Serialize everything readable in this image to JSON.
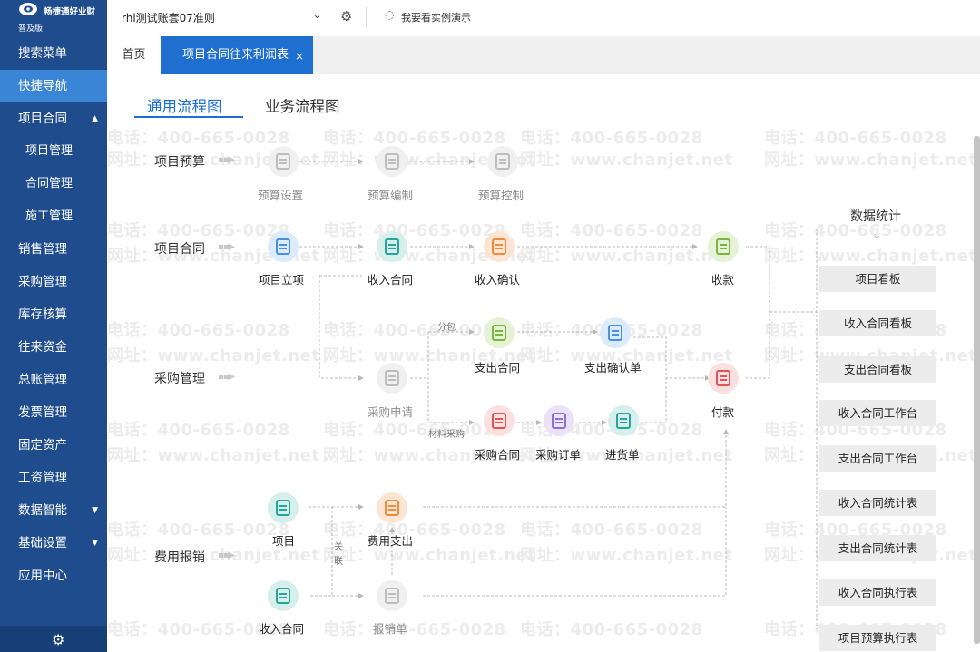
{
  "app": {
    "logo_text": "畅捷通好业财",
    "edition": "普及版"
  },
  "sidebar": {
    "items": [
      {
        "label": "搜索菜单"
      },
      {
        "label": "快捷导航"
      },
      {
        "label": "项目合同",
        "arrow": "▲"
      },
      {
        "label": "项目管理"
      },
      {
        "label": "合同管理"
      },
      {
        "label": "施工管理"
      },
      {
        "label": "销售管理"
      },
      {
        "label": "采购管理"
      },
      {
        "label": "库存核算"
      },
      {
        "label": "往来资金"
      },
      {
        "label": "总账管理"
      },
      {
        "label": "发票管理"
      },
      {
        "label": "固定资产"
      },
      {
        "label": "工资管理"
      },
      {
        "label": "数据智能",
        "arrow": "▼"
      },
      {
        "label": "基础设置",
        "arrow": "▼"
      },
      {
        "label": "应用中心"
      }
    ],
    "footer_icon": "gear-icon"
  },
  "topbar": {
    "account": "rhl测试账套07准则",
    "demo_link": "我要看实例演示"
  },
  "tabs": {
    "home": "首页",
    "active": "项目合同往来利润表",
    "close": "×"
  },
  "subtabs": {
    "general": "通用流程图",
    "business": "业务流程图"
  },
  "watermark": {
    "phone": "电话：400-665-0028",
    "site": "网址：www.chanjet.net"
  },
  "rows": {
    "budget": "项目预算",
    "contract": "项目合同",
    "purchase": "采购管理",
    "expense": "费用报销"
  },
  "nodes": {
    "budget_setup": "预算设置",
    "budget_compile": "预算编制",
    "budget_control": "预算控制",
    "project_setup": "项目立项",
    "income_contract": "收入合同",
    "income_confirm": "收入确认",
    "receipt": "收款",
    "expense_contract": "支出合同",
    "expense_confirm": "支出确认单",
    "purchase_request": "采购申请",
    "payment": "付款",
    "purchase_contract": "采购合同",
    "purchase_order": "采购订单",
    "inbound": "进货单",
    "project": "项目",
    "expense_out": "费用支出",
    "income_contract_2": "收入合同",
    "reimburse": "报销单"
  },
  "flow_labels": {
    "subcontract": "分包",
    "material_purchase": "材料采购",
    "link_1": "关",
    "link_2": "联"
  },
  "stats": {
    "title": "数据统计",
    "reports": [
      "项目看板",
      "收入合同看板",
      "支出合同看板",
      "收入合同工作台",
      "支出合同工作台",
      "收入合同统计表",
      "支出合同统计表",
      "收入合同执行表",
      "项目预算执行表"
    ]
  },
  "colors": {
    "sidebar": "#1e4c8c",
    "sidebar_active": "#3a85d6",
    "tab_active": "#1e6fd0",
    "icon_gray": "#bdbdbd",
    "icon_blue": "#4a90e2",
    "icon_teal": "#26a69a",
    "icon_orange": "#f08a3c",
    "icon_green": "#7cb342",
    "icon_red": "#e05555",
    "icon_purple": "#8e6fd8"
  }
}
